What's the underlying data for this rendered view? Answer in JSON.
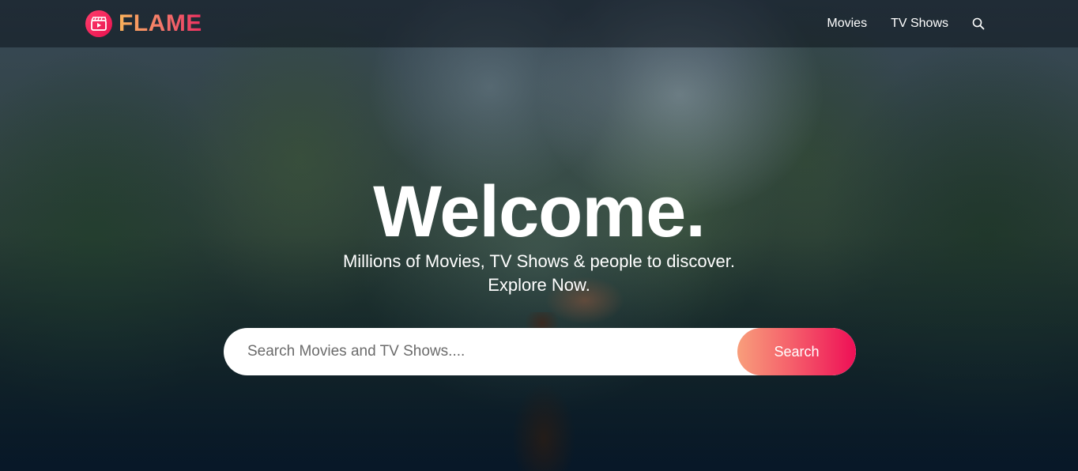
{
  "header": {
    "logo_text": "FLAME",
    "logo_icon": "clapperboard-play-icon",
    "nav": [
      {
        "label": "Movies"
      },
      {
        "label": "TV Shows"
      }
    ],
    "search_icon": "search-icon"
  },
  "hero": {
    "title": "Welcome.",
    "subtitle_line1": "Millions of Movies, TV Shows & people to discover.",
    "subtitle_line2": "Explore Now.",
    "background_image": "jungle-scene-with-rider-and-eagle"
  },
  "search": {
    "placeholder": "Search Movies and TV Shows....",
    "button_label": "Search"
  },
  "colors": {
    "accent_start": "#f89e7b",
    "accent_end": "#ee0f56",
    "logo_gradient_start": "#f9b25a",
    "logo_gradient_end": "#ea2e5f",
    "header_bg": "rgba(12,20,28,0.55)"
  }
}
